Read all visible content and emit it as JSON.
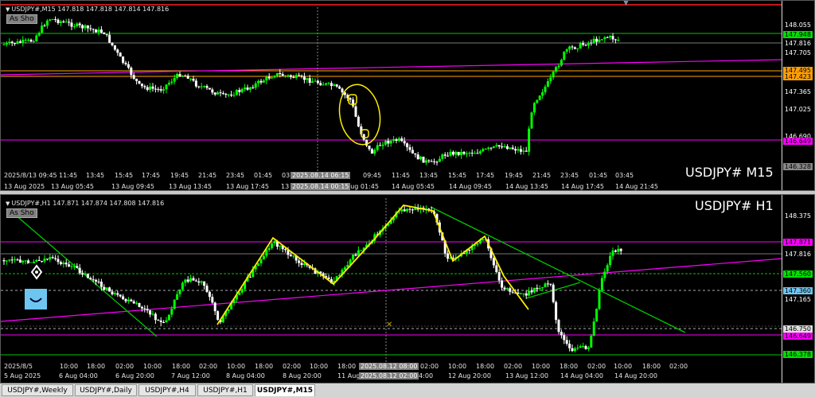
{
  "colors": {
    "bg": "#000000",
    "bull": "#00ff00",
    "bear": "#ffffff",
    "trend": "#00c800",
    "magenta": "#ff00ff",
    "yellow": "#ffee00"
  },
  "m15": {
    "header": "USDJPY#,M15  147.818 147.818 147.814 147.816",
    "as_show": "As Sho",
    "symbol": "USDJPY# M15",
    "cross_time_top": "2025.08.14 06:15",
    "cross_time_bottom": "2025.08.14 00:15",
    "price_labels": [
      "148.055",
      "147.948",
      "147.816",
      "147.705",
      "147.495",
      "147.423",
      "147.365",
      "147.025",
      "146.690",
      "146.649",
      "146.328"
    ],
    "time_row1": [
      "2025/8/13 09:45",
      "11:45",
      "13:45",
      "15:45",
      "17:45",
      "19:45",
      "21:45",
      "23:45",
      "01:45",
      "03:",
      "45",
      "09:45",
      "11:45",
      "13:45",
      "15:45",
      "17:45",
      "19:45",
      "21:45",
      "23:45",
      "01:45",
      "03:45"
    ],
    "time_row2": [
      "13 Aug 2025",
      "13 Aug 05:45",
      "13 Aug 09:45",
      "13 Aug 13:45",
      "13 Aug 17:45",
      "13",
      "14 Aug 01:45",
      "14 Aug 05:45",
      "14 Aug 09:45",
      "14 Aug 13:45",
      "14 Aug 17:45",
      "14 Aug 21:45"
    ]
  },
  "h1": {
    "header": "USDJPY#,H1  147.871 147.874 147.808 147.816",
    "as_show": "As Sho",
    "symbol": "USDJPY# H1",
    "cross_time_top": "2025.08.12 08:00",
    "cross_time_bottom": "2025.08.12 02:00",
    "price_labels": [
      "148.375",
      "147.871",
      "147.816",
      "147.560",
      "147.360",
      "147.165",
      "146.750",
      "146.649",
      "146.378"
    ],
    "time_row1": [
      "2025/8/5",
      "10:00",
      "18:00",
      "02:00",
      "10:00",
      "18:00",
      "02:00",
      "10:00",
      "18:00",
      "02:00",
      "10:00",
      "18:00",
      "02:00",
      "10:00",
      "18:00",
      "02:00",
      "10:00",
      "18:00",
      "02:00",
      "10:00",
      "18:00",
      "02:00"
    ],
    "time_row2": [
      "5 Aug 2025",
      "6 Aug 04:00",
      "6 Aug 20:00",
      "7 Aug 12:00",
      "8 Aug 04:00",
      "8 Aug 20:00",
      "11 Aug",
      "04:00",
      "12 Aug 20:00",
      "13 Aug 12:00",
      "14 Aug 04:00",
      "14 Aug 20:00"
    ]
  },
  "tabs": [
    "USDJPY#,Weekly",
    "USDJPY#,Daily",
    "USDJPY#,H4",
    "USDJPY#,H1",
    "USDJPY#,M15"
  ],
  "active_tab": "USDJPY#,M15"
}
